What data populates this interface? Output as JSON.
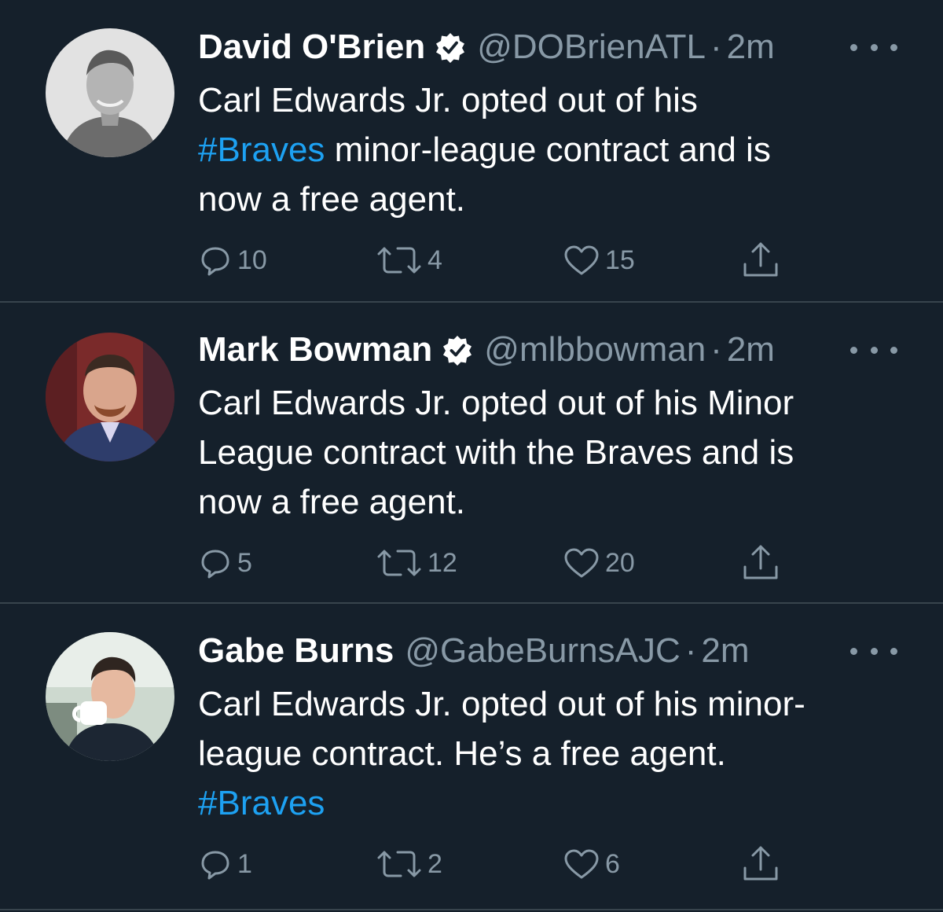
{
  "colors": {
    "background": "#15202b",
    "text": "#ffffff",
    "secondary_text": "#8899a6",
    "link": "#1da1f2",
    "divider": "#38444d"
  },
  "tweets": [
    {
      "name": "David O'Brien",
      "verified": true,
      "handle": "@DOBrienATL",
      "separator": "·",
      "time": "2m",
      "text_lines": [
        [
          {
            "text": "Carl Edwards Jr. opted out of his"
          }
        ],
        [
          {
            "text": "#Braves",
            "hashtag": true
          },
          {
            "text": " minor-league contract and is"
          }
        ],
        [
          {
            "text": "now a free agent."
          }
        ]
      ],
      "replies": "10",
      "retweets": "4",
      "likes": "15",
      "icons": [
        "reply-icon",
        "retweet-icon",
        "like-icon",
        "share-icon",
        "more-icon",
        "verified-badge-icon"
      ]
    },
    {
      "name": "Mark Bowman",
      "verified": true,
      "handle": "@mlbbowman",
      "separator": "·",
      "time": "2m",
      "text_lines": [
        [
          {
            "text": "Carl Edwards Jr. opted out of his Minor"
          }
        ],
        [
          {
            "text": "League contract with the Braves and is"
          }
        ],
        [
          {
            "text": "now a free agent."
          }
        ]
      ],
      "replies": "5",
      "retweets": "12",
      "likes": "20",
      "icons": [
        "reply-icon",
        "retweet-icon",
        "like-icon",
        "share-icon",
        "more-icon",
        "verified-badge-icon"
      ]
    },
    {
      "name": "Gabe Burns",
      "verified": false,
      "handle": "@GabeBurnsAJC",
      "separator": "·",
      "time": "2m",
      "text_lines": [
        [
          {
            "text": "Carl Edwards Jr. opted out of his minor-"
          }
        ],
        [
          {
            "text": "league contract. He’s a free agent."
          }
        ],
        [
          {
            "text": "#Braves",
            "hashtag": true
          }
        ]
      ],
      "replies": "1",
      "retweets": "2",
      "likes": "6",
      "icons": [
        "reply-icon",
        "retweet-icon",
        "like-icon",
        "share-icon",
        "more-icon"
      ]
    }
  ]
}
